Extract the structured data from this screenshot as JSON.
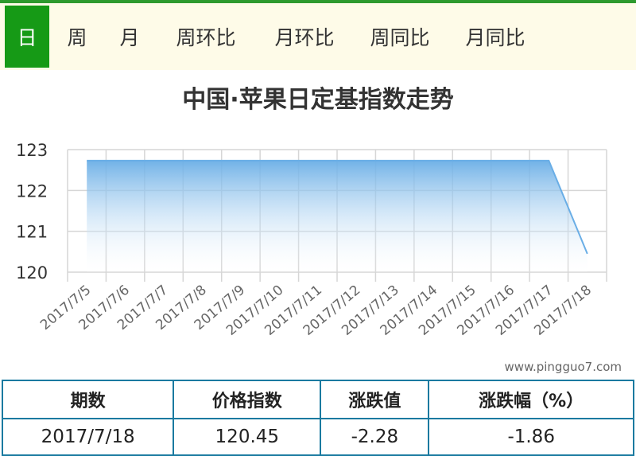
{
  "tabs": [
    {
      "label": "日",
      "active": true
    },
    {
      "label": "周",
      "active": false
    },
    {
      "label": "月",
      "active": false
    },
    {
      "label": "周环比",
      "active": false
    },
    {
      "label": "月环比",
      "active": false
    },
    {
      "label": "周同比",
      "active": false
    },
    {
      "label": "月同比",
      "active": false
    }
  ],
  "colors": {
    "accent": "#169a16",
    "line": "#6aaee6",
    "fill_top": "#6aaee6",
    "table_border": "#1a7aa0"
  },
  "watermark": "www.pingguo7.com",
  "table": {
    "headers": [
      "期数",
      "价格指数",
      "涨跌值",
      "涨跌幅（%）"
    ],
    "row": [
      "2017/7/18",
      "120.45",
      "-2.28",
      "-1.86"
    ]
  },
  "chart_data": {
    "type": "area",
    "title": "中国·苹果日定基指数走势",
    "categories": [
      "2017/7/5",
      "2017/7/6",
      "2017/7/7",
      "2017/7/8",
      "2017/7/9",
      "2017/7/10",
      "2017/7/11",
      "2017/7/12",
      "2017/7/13",
      "2017/7/14",
      "2017/7/15",
      "2017/7/16",
      "2017/7/17",
      "2017/7/18"
    ],
    "values": [
      122.73,
      122.73,
      122.73,
      122.73,
      122.73,
      122.73,
      122.73,
      122.73,
      122.73,
      122.73,
      122.73,
      122.73,
      122.73,
      120.45
    ],
    "ylim": [
      120,
      123
    ],
    "yticks": [
      120,
      121,
      122,
      123
    ],
    "grid": true,
    "xlabel": "",
    "ylabel": ""
  }
}
